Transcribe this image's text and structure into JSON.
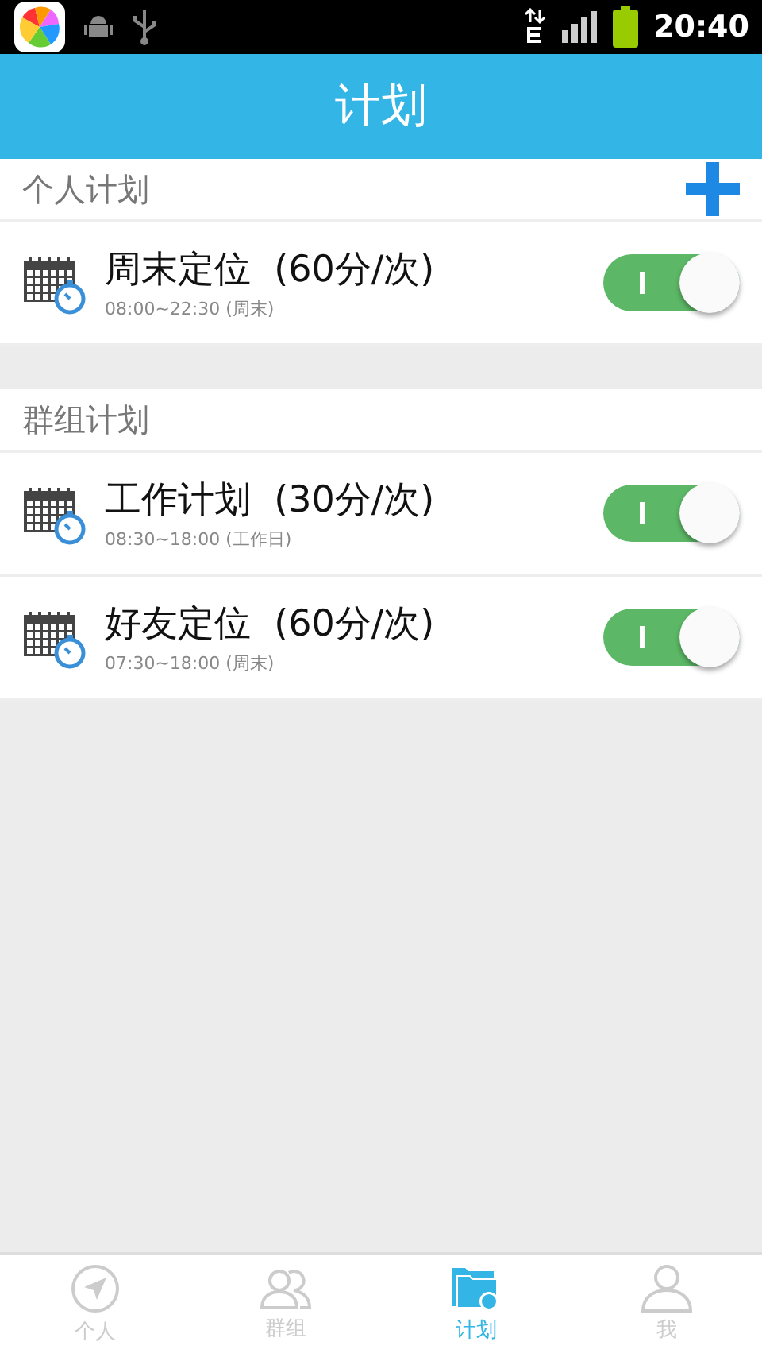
{
  "status_bar": {
    "time": "20:40"
  },
  "header": {
    "title": "计划"
  },
  "sections": [
    {
      "title": "个人计划",
      "add_button": true,
      "plans": [
        {
          "name": "周末定位",
          "interval": "(60分/次)",
          "schedule": "08:00~22:30 (周末)",
          "on": true
        }
      ]
    },
    {
      "title": "群组计划",
      "add_button": false,
      "plans": [
        {
          "name": "工作计划",
          "interval": "(30分/次)",
          "schedule": "08:30~18:00 (工作日)",
          "on": true
        },
        {
          "name": "好友定位",
          "interval": "(60分/次)",
          "schedule": "07:30~18:00 (周末)",
          "on": true
        }
      ]
    }
  ],
  "tabs": [
    {
      "label": "个人",
      "kind": "compass",
      "selected": false
    },
    {
      "label": "群组",
      "kind": "group",
      "selected": false
    },
    {
      "label": "计划",
      "kind": "folder",
      "selected": true
    },
    {
      "label": "我",
      "kind": "person",
      "selected": false
    }
  ]
}
